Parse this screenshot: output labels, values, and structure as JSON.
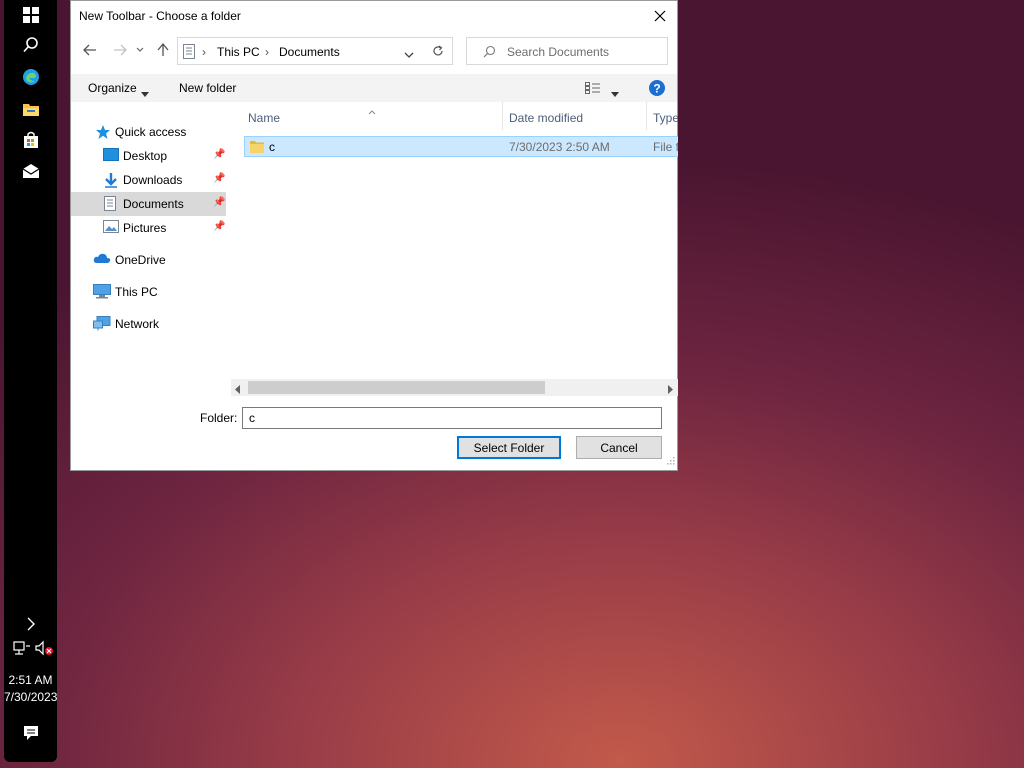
{
  "taskbar": {
    "icons": [
      "windows-start-icon",
      "search-icon",
      "edge-icon",
      "file-explorer-icon",
      "store-icon",
      "mail-icon"
    ],
    "time": "2:51 AM",
    "date": "7/30/2023"
  },
  "dialog": {
    "title": "New Toolbar - Choose a folder",
    "address": {
      "seg1": "This PC",
      "seg2": "Documents"
    },
    "search_placeholder": "Search Documents",
    "commands": {
      "organize": "Organize",
      "new_folder": "New folder"
    },
    "nav": [
      {
        "label": "Quick access"
      },
      {
        "label": "Desktop"
      },
      {
        "label": "Downloads"
      },
      {
        "label": "Documents"
      },
      {
        "label": "Pictures"
      },
      {
        "label": "OneDrive"
      },
      {
        "label": "This PC"
      },
      {
        "label": "Network"
      }
    ],
    "columns": {
      "name": "Name",
      "date": "Date modified",
      "type": "Type"
    },
    "rows": [
      {
        "name": "c",
        "date": "7/30/2023 2:50 AM",
        "type": "File folder"
      }
    ],
    "folder_label": "Folder:",
    "folder_value": "c",
    "select_button": "Select Folder",
    "cancel_button": "Cancel"
  },
  "colors": {
    "accent": "#0078d7",
    "selection": "#cce8ff",
    "help": "#1a6fd1"
  }
}
